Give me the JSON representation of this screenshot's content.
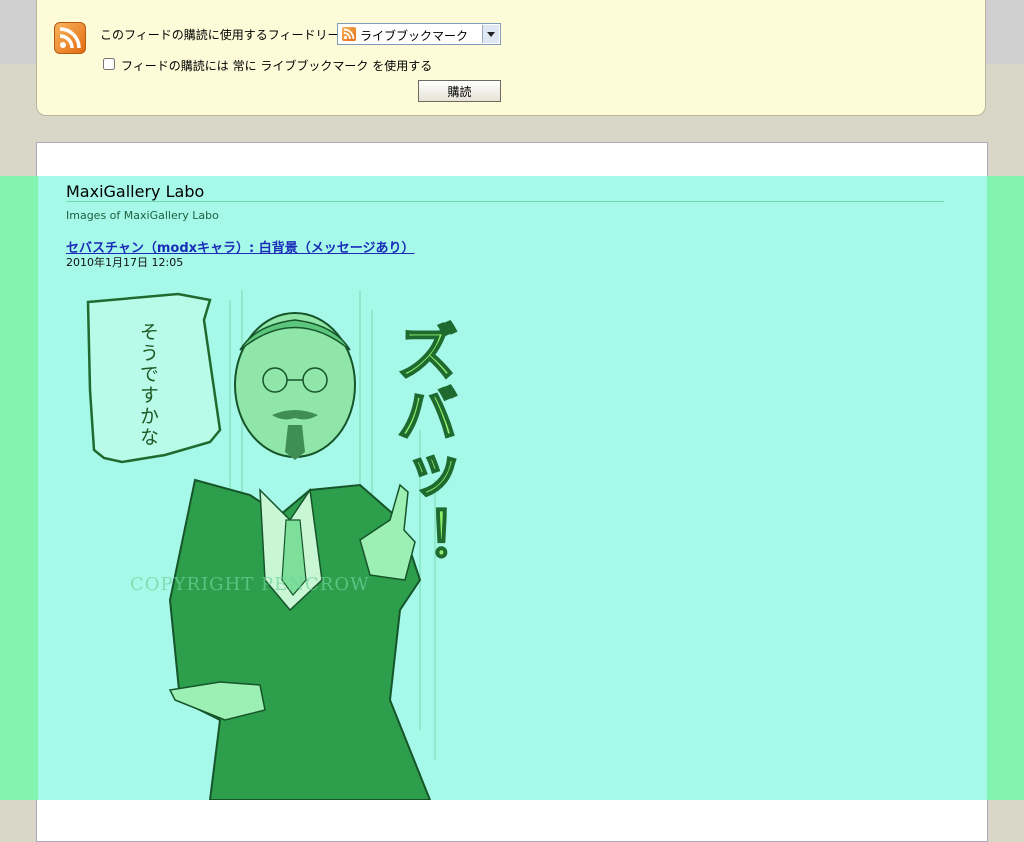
{
  "subscribe": {
    "reader_label": "このフィードの購読に使用するフィードリーダー:",
    "selected_reader": "ライブブックマーク",
    "always_use_text": "フィードの購読には 常に ライブブックマーク を使用する",
    "always_use_checked": false,
    "subscribe_button": "購読",
    "icon": "rss-feed-icon"
  },
  "feed": {
    "title": "MaxiGallery Labo",
    "subtitle": "Images of MaxiGallery Labo",
    "post": {
      "title": "セバスチャン（modxキャラ）: 白背景（メッセージあり）",
      "date": "2010年1月17日 12:05"
    }
  },
  "artwork": {
    "speech_bubble_text": "そうですかな",
    "sound_effect": "ズバッ！",
    "watermark": "COPYRIGHT PENCROW"
  },
  "colors": {
    "subscribe_bg": "#fdfbd8",
    "overlay_outer": "#83f3b1",
    "overlay_inner": "#a6f9e8",
    "link": "#1a2cb8"
  }
}
